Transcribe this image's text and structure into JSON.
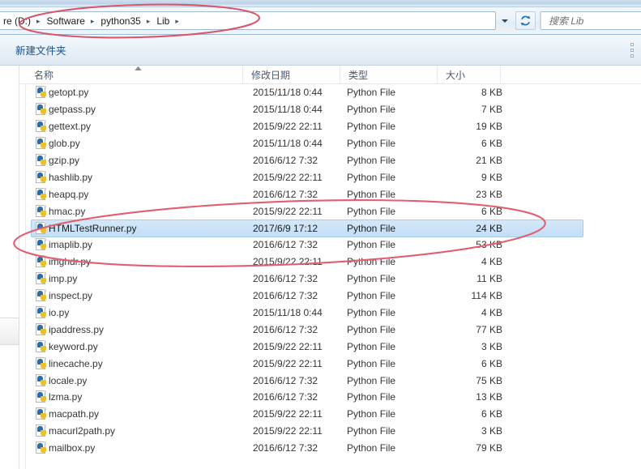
{
  "window": {
    "kind": "windows-explorer"
  },
  "addressbar": {
    "breadcrumbs": [
      {
        "label": "re (D:)"
      },
      {
        "label": "Software"
      },
      {
        "label": "python35"
      },
      {
        "label": "Lib"
      }
    ],
    "separator": "▸",
    "dropdown_icon": "chevron-down-icon",
    "refresh_icon": "refresh-icon"
  },
  "search": {
    "placeholder": "搜索 Lib",
    "icon": "search-icon"
  },
  "toolbar": {
    "new_folder_label": "新建文件夹",
    "grip_icon": "toolbar-overflow-icon"
  },
  "columns": {
    "name": "名称",
    "date_modified": "修改日期",
    "type": "类型",
    "size": "大小"
  },
  "colors": {
    "selection_fill": "#c3def6",
    "selection_border": "#a8cdeb",
    "annotation_red": "#e05a6e",
    "toolbar_link": "#14508a"
  },
  "files": [
    {
      "name": "getopt.py",
      "date": "2015/11/18 0:44",
      "type": "Python File",
      "size": "8 KB",
      "selected": false
    },
    {
      "name": "getpass.py",
      "date": "2015/11/18 0:44",
      "type": "Python File",
      "size": "7 KB",
      "selected": false
    },
    {
      "name": "gettext.py",
      "date": "2015/9/22 22:11",
      "type": "Python File",
      "size": "19 KB",
      "selected": false
    },
    {
      "name": "glob.py",
      "date": "2015/11/18 0:44",
      "type": "Python File",
      "size": "6 KB",
      "selected": false
    },
    {
      "name": "gzip.py",
      "date": "2016/6/12 7:32",
      "type": "Python File",
      "size": "21 KB",
      "selected": false
    },
    {
      "name": "hashlib.py",
      "date": "2015/9/22 22:11",
      "type": "Python File",
      "size": "9 KB",
      "selected": false
    },
    {
      "name": "heapq.py",
      "date": "2016/6/12 7:32",
      "type": "Python File",
      "size": "23 KB",
      "selected": false
    },
    {
      "name": "hmac.py",
      "date": "2015/9/22 22:11",
      "type": "Python File",
      "size": "6 KB",
      "selected": false
    },
    {
      "name": "HTMLTestRunner.py",
      "date": "2017/6/9 17:12",
      "type": "Python File",
      "size": "24 KB",
      "selected": true
    },
    {
      "name": "imaplib.py",
      "date": "2016/6/12 7:32",
      "type": "Python File",
      "size": "53 KB",
      "selected": false
    },
    {
      "name": "imghdr.py",
      "date": "2015/9/22 22:11",
      "type": "Python File",
      "size": "4 KB",
      "selected": false
    },
    {
      "name": "imp.py",
      "date": "2016/6/12 7:32",
      "type": "Python File",
      "size": "11 KB",
      "selected": false
    },
    {
      "name": "inspect.py",
      "date": "2016/6/12 7:32",
      "type": "Python File",
      "size": "114 KB",
      "selected": false
    },
    {
      "name": "io.py",
      "date": "2015/11/18 0:44",
      "type": "Python File",
      "size": "4 KB",
      "selected": false
    },
    {
      "name": "ipaddress.py",
      "date": "2016/6/12 7:32",
      "type": "Python File",
      "size": "77 KB",
      "selected": false
    },
    {
      "name": "keyword.py",
      "date": "2015/9/22 22:11",
      "type": "Python File",
      "size": "3 KB",
      "selected": false
    },
    {
      "name": "linecache.py",
      "date": "2015/9/22 22:11",
      "type": "Python File",
      "size": "6 KB",
      "selected": false
    },
    {
      "name": "locale.py",
      "date": "2016/6/12 7:32",
      "type": "Python File",
      "size": "75 KB",
      "selected": false
    },
    {
      "name": "lzma.py",
      "date": "2016/6/12 7:32",
      "type": "Python File",
      "size": "13 KB",
      "selected": false
    },
    {
      "name": "macpath.py",
      "date": "2015/9/22 22:11",
      "type": "Python File",
      "size": "6 KB",
      "selected": false
    },
    {
      "name": "macurl2path.py",
      "date": "2015/9/22 22:11",
      "type": "Python File",
      "size": "3 KB",
      "selected": false
    },
    {
      "name": "mailbox.py",
      "date": "2016/6/12 7:32",
      "type": "Python File",
      "size": "79 KB",
      "selected": false
    },
    {
      "name": "",
      "date": "",
      "type": "",
      "size": "",
      "selected": false
    }
  ],
  "annotations": [
    {
      "name": "breadcrumb-ellipse",
      "shape": "ellipse"
    },
    {
      "name": "selected-file-ellipse",
      "shape": "ellipse"
    }
  ]
}
